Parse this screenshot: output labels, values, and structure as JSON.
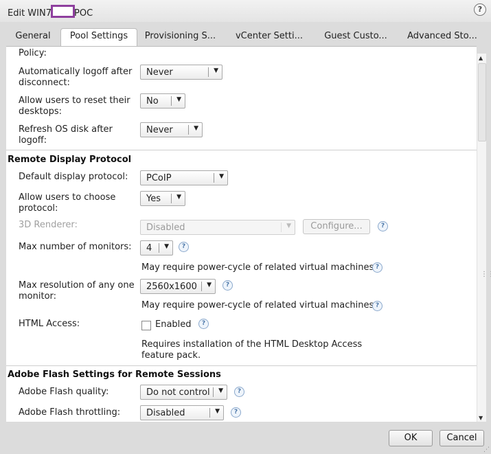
{
  "dialog": {
    "title_prefix": "Edit WIN7",
    "title_suffix": "POC",
    "help_glyph": "?"
  },
  "tabs": [
    {
      "label": "General"
    },
    {
      "label": "Pool Settings"
    },
    {
      "label": "Provisioning S..."
    },
    {
      "label": "vCenter Setti..."
    },
    {
      "label": "Guest Custo..."
    },
    {
      "label": "Advanced Sto..."
    }
  ],
  "session": {
    "partial_label": "Policy:",
    "auto_logoff": {
      "label_line1": "Automatically logoff after",
      "label_line2": "disconnect:",
      "value": "Never"
    },
    "allow_reset": {
      "label_line1": "Allow users to reset their",
      "label_line2": "desktops:",
      "value": "No"
    },
    "refresh_os": {
      "label_line1": "Refresh OS disk after",
      "label_line2": "logoff:",
      "value": "Never"
    }
  },
  "remote_display": {
    "heading": "Remote Display Protocol",
    "default_protocol": {
      "label": "Default display protocol:",
      "value": "PCoIP"
    },
    "allow_choose": {
      "label_line1": "Allow users to choose",
      "label_line2": "protocol:",
      "value": "Yes"
    },
    "renderer": {
      "label": "3D Renderer:",
      "value": "Disabled",
      "configure_label": "Configure..."
    },
    "max_monitors": {
      "label": "Max number of monitors:",
      "value": "4",
      "note": "May require power-cycle of related virtual machines"
    },
    "max_resolution": {
      "label_line1": "Max resolution of any one",
      "label_line2": "monitor:",
      "value": "2560x1600",
      "note": "May require power-cycle of related virtual machines"
    },
    "html_access": {
      "label": "HTML Access:",
      "checkbox_label": "Enabled",
      "note_line1": "Requires installation of the HTML Desktop Access",
      "note_line2": "feature pack."
    }
  },
  "flash": {
    "heading": "Adobe Flash Settings for Remote Sessions",
    "quality": {
      "label": "Adobe Flash quality:",
      "value": "Do not control"
    },
    "throttling": {
      "label": "Adobe Flash throttling:",
      "value": "Disabled"
    }
  },
  "footer": {
    "ok_label": "OK",
    "cancel_label": "Cancel"
  },
  "icons": {
    "help": "help-icon",
    "dropdown": "chevron-down-icon",
    "scroll_up": "arrow-up-icon",
    "scroll_down": "arrow-down-icon"
  }
}
